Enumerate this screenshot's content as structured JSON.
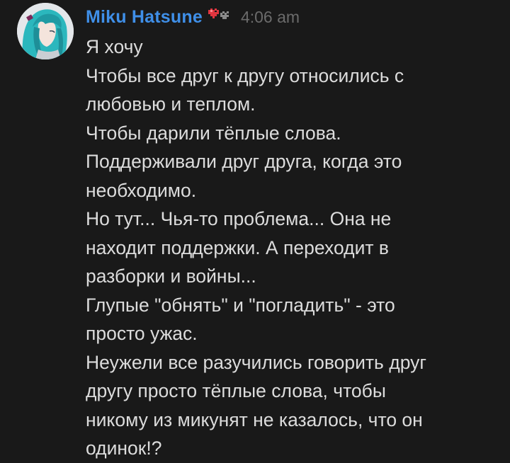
{
  "message": {
    "username": "Miku Hatsune",
    "timestamp": "4:06 am",
    "avatar_icon": "miku-avatar",
    "badge_icon": "pixel-hearts-icon",
    "colors": {
      "username": "#3f8fe8",
      "text": "#dcdcdc",
      "timestamp": "#6b6b6b",
      "background": "#191919"
    },
    "lines": [
      "Я хочу",
      "Чтобы все друг к другу относились с",
      "любовью и теплом.",
      "Чтобы дарили тёплые слова.",
      "Поддерживали друг друга, когда это",
      "необходимо.",
      "Но тут... Чья-то проблема... Она не",
      "находит поддержки. А переходит в",
      "разборки и войны...",
      "Глупые \"обнять\" и \"погладить\" - это",
      "просто ужас.",
      "Неужели все разучились говорить друг",
      "другу просто тёплые слова, чтобы",
      "никому из микунят не казалось, что он",
      "одинок!?"
    ]
  }
}
